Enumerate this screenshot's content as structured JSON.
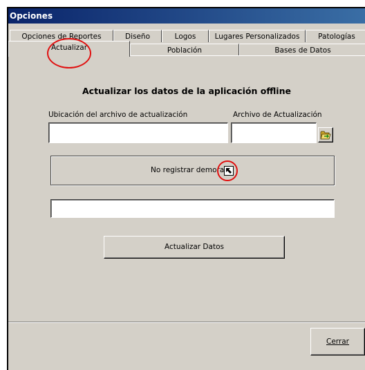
{
  "window": {
    "title": "Opciones"
  },
  "tabs": {
    "row1": [
      "Opciones de Reportes",
      "Diseño",
      "Logos",
      "Lugares Personalizados",
      "Patologías"
    ],
    "row2": [
      "Actualizar",
      "Población",
      "Bases de Datos"
    ],
    "active": "Actualizar"
  },
  "content": {
    "heading": "Actualizar los datos de la aplicación offline",
    "location_label": "Ubicación del archivo de actualización",
    "location_value": "",
    "file_label": "Archivo de Actualización",
    "file_value": "",
    "no_delay_label": "No registrar demoras",
    "progress_value": "",
    "update_button": "Actualizar Datos"
  },
  "footer": {
    "close_button": "Cerrar"
  },
  "annotations": {
    "color": "#e01010"
  },
  "icons": {
    "browse": "open-folder-icon",
    "no_delay": "arrow-up-left-icon"
  }
}
